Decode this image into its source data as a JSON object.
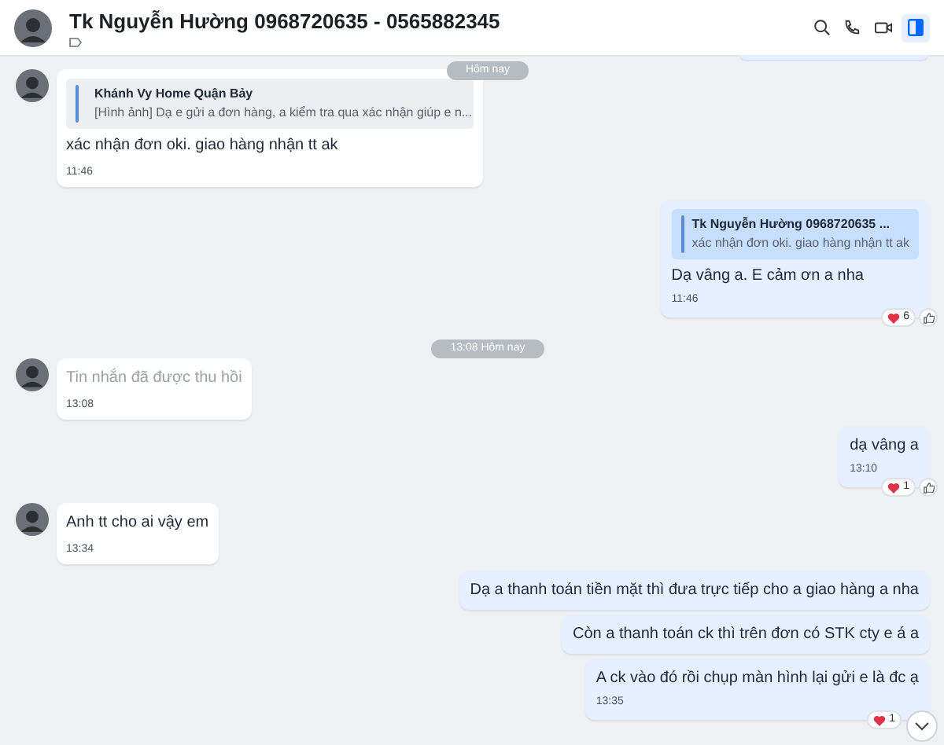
{
  "header": {
    "title": "Tk Nguyễn Hường 0968720635 - 0565882345"
  },
  "messages": [
    {
      "kind": "cut"
    },
    {
      "kind": "date",
      "text": "Hôm nay"
    },
    {
      "kind": "in",
      "quote": {
        "title": "Khánh Vy Home Quận Bảy",
        "text": "[Hình ảnh] Dạ e gửi a đơn hàng, a kiểm tra qua xác nhận giúp e n..."
      },
      "text": "xác nhận đơn oki. giao hàng nhận tt ak",
      "time": "11:46"
    },
    {
      "kind": "out",
      "quote": {
        "title": "Tk Nguyễn Hường 0968720635 ...",
        "text": "xác nhận đơn oki. giao hàng nhận tt ak"
      },
      "text": "Dạ vâng a. E cảm ơn a nha",
      "time": "11:46",
      "reaction": "6"
    },
    {
      "kind": "date",
      "text": "13:08 Hôm nay"
    },
    {
      "kind": "in",
      "recalled": true,
      "text": "Tin nhắn đã được thu hồi",
      "time": "13:08"
    },
    {
      "kind": "out",
      "text": "dạ vâng a",
      "time": "13:10",
      "reaction": "1"
    },
    {
      "kind": "in",
      "text": "Anh tt cho ai vậy em",
      "time": "13:34"
    },
    {
      "kind": "out",
      "text": "Dạ a thanh toán tiền mặt thì đưa trực tiếp cho a giao hàng a nha"
    },
    {
      "kind": "out",
      "text": "Còn a thanh toán ck thì trên đơn có STK cty e á a"
    },
    {
      "kind": "out",
      "text": "A ck vào đó rồi chụp màn hình lại gửi e là đc ạ",
      "time": "13:35",
      "reaction": "1"
    }
  ]
}
